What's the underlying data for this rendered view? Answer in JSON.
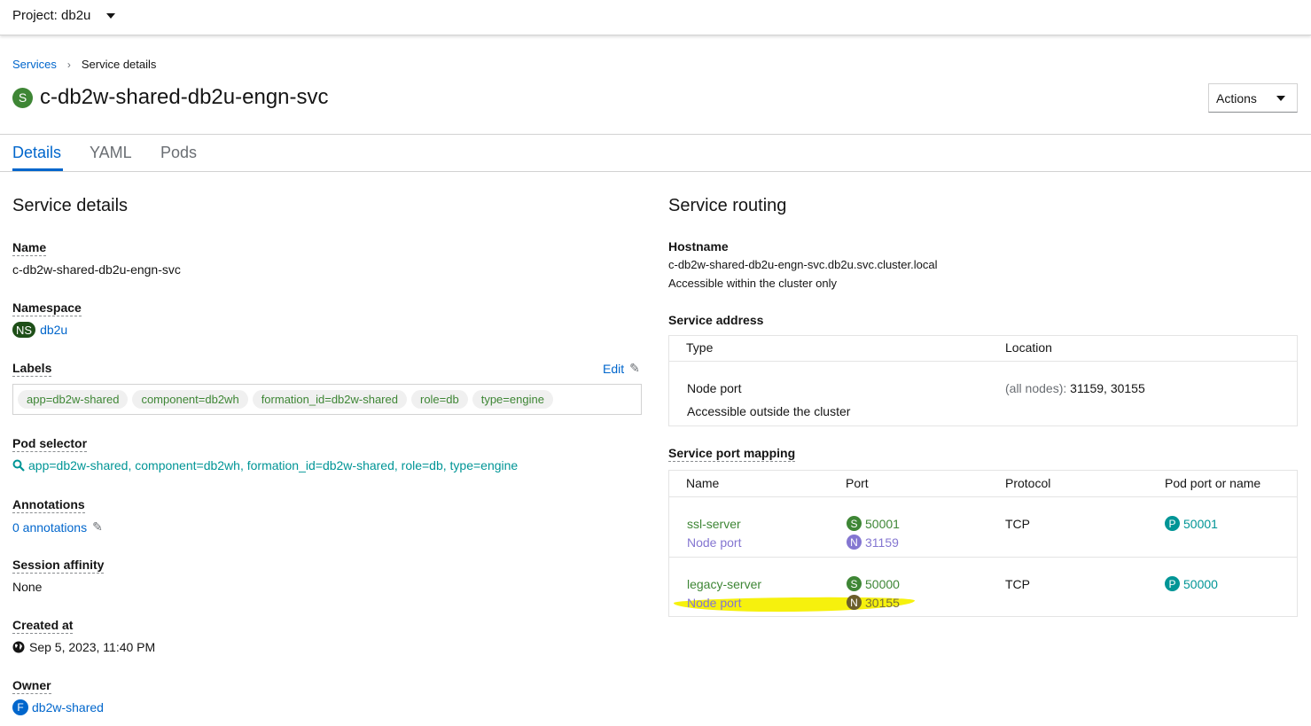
{
  "topbar": {
    "project_label": "Project: db2u"
  },
  "breadcrumb": {
    "services": "Services",
    "current": "Service details"
  },
  "title": {
    "badge": "S",
    "name": "c-db2w-shared-db2u-engn-svc"
  },
  "actions": {
    "label": "Actions"
  },
  "tabs": [
    "Details",
    "YAML",
    "Pods"
  ],
  "details": {
    "heading": "Service details",
    "name_label": "Name",
    "name_value": "c-db2w-shared-db2u-engn-svc",
    "namespace_label": "Namespace",
    "namespace_badge": "NS",
    "namespace_value": "db2u",
    "labels_label": "Labels",
    "edit_label": "Edit",
    "labels": [
      "app=db2w-shared",
      "component=db2wh",
      "formation_id=db2w-shared",
      "role=db",
      "type=engine"
    ],
    "pod_selector_label": "Pod selector",
    "pod_selector_value": "app=db2w-shared, component=db2wh, formation_id=db2w-shared, role=db, type=engine",
    "annotations_label": "Annotations",
    "annotations_value": "0 annotations",
    "session_affinity_label": "Session affinity",
    "session_affinity_value": "None",
    "created_at_label": "Created at",
    "created_at_value": "Sep 5, 2023, 11:40 PM",
    "owner_label": "Owner",
    "owner_badge": "F",
    "owner_value": "db2w-shared"
  },
  "routing": {
    "heading": "Service routing",
    "hostname_label": "Hostname",
    "hostname_value": "c-db2w-shared-db2u-engn-svc.db2u.svc.cluster.local",
    "hostname_note": "Accessible within the cluster only",
    "address_label": "Service address",
    "address_headers": {
      "type": "Type",
      "location": "Location"
    },
    "address_row": {
      "type": "Node port",
      "type_note": "Accessible outside the cluster",
      "location_prefix": "(all nodes):",
      "location_ports": "31159, 30155"
    },
    "mapping_label": "Service port mapping",
    "mapping_headers": {
      "name": "Name",
      "port": "Port",
      "protocol": "Protocol",
      "pod_port": "Pod port or name"
    },
    "mapping_rows": [
      {
        "name": "ssl-server",
        "node_label": "Node port",
        "s_badge": "S",
        "port": "50001",
        "n_badge": "N",
        "node_port": "31159",
        "protocol": "TCP",
        "p_badge": "P",
        "pod_port": "50001"
      },
      {
        "name": "legacy-server",
        "node_label": "Node port",
        "s_badge": "S",
        "port": "50000",
        "n_badge": "N",
        "node_port": "30155",
        "protocol": "TCP",
        "p_badge": "P",
        "pod_port": "50000"
      }
    ]
  },
  "colors": {
    "link": "#0066cc",
    "green": "#3e8635",
    "teal": "#009596",
    "purple": "#8476d1",
    "highlight": "#f6f000"
  }
}
